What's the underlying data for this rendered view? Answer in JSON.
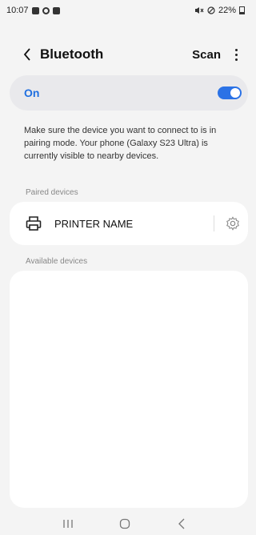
{
  "status_bar": {
    "time": "10:07",
    "battery": "22%",
    "left_icons": [
      "gallery-notification-icon",
      "settings-notification-icon",
      "message-notification-icon"
    ],
    "right_icons": [
      "mute-icon",
      "do-not-disturb-icon",
      "battery-icon"
    ]
  },
  "header": {
    "title": "Bluetooth",
    "scan_label": "Scan"
  },
  "toggle": {
    "label": "On",
    "state": true,
    "accent_color": "#2b72e6"
  },
  "info": {
    "text": "Make sure the device you want to connect to is in pairing mode. Your phone (Galaxy S23 Ultra) is currently visible to nearby devices."
  },
  "paired": {
    "section_label": "Paired devices",
    "devices": [
      {
        "name": "PRINTER NAME",
        "icon": "printer-icon"
      }
    ]
  },
  "available": {
    "section_label": "Available devices",
    "devices": []
  },
  "nav": {
    "buttons": [
      "recents-icon",
      "home-icon",
      "back-icon"
    ]
  }
}
